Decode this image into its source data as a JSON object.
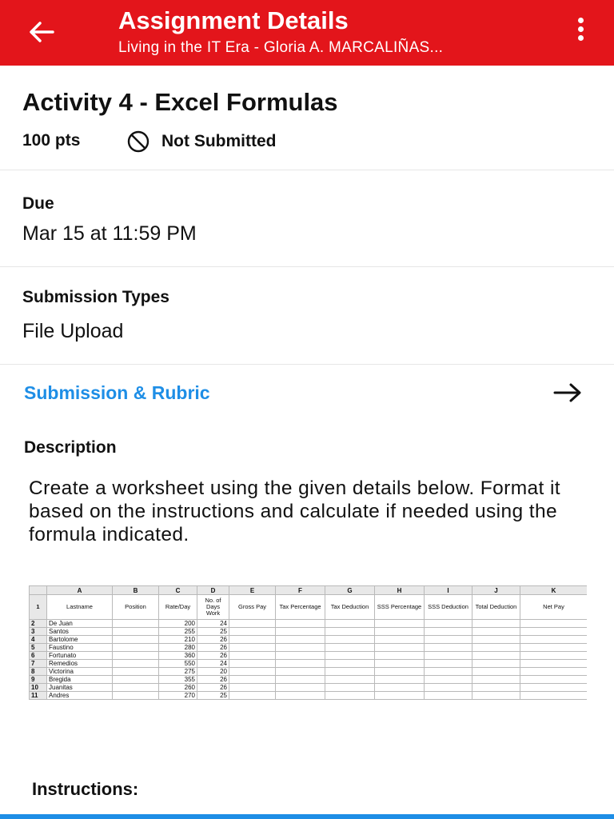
{
  "app_bar": {
    "title": "Assignment Details",
    "subtitle": "Living in the IT Era - Gloria A. MARCALIÑAS...",
    "back_icon": "arrow-left-icon",
    "menu_icon": "more-vertical-icon",
    "color": "#e3151b"
  },
  "assignment": {
    "title": "Activity 4 - Excel Formulas",
    "points": "100 pts",
    "status": "Not Submitted",
    "status_icon": "not-allowed-icon"
  },
  "due": {
    "label": "Due",
    "value": "Mar 15 at 11:59 PM"
  },
  "submission_types": {
    "label": "Submission Types",
    "value": "File Upload"
  },
  "submission_rubric": {
    "label": "Submission & Rubric",
    "icon": "arrow-right-icon",
    "color": "#1e8ee6"
  },
  "description": {
    "label": "Description",
    "text": "Create a worksheet using the given details below.  Format it based on the instructions and calculate if needed using the formula indicated."
  },
  "spreadsheet": {
    "column_letters": [
      "A",
      "B",
      "C",
      "D",
      "E",
      "F",
      "G",
      "H",
      "I",
      "J",
      "K"
    ],
    "headers": [
      "Lastname",
      "Position",
      "Rate/Day",
      "No. of Days Work",
      "Gross Pay",
      "Tax Percentage",
      "Tax Deduction",
      "SSS Percentage",
      "SSS Deduction",
      "Total Deduction",
      "Net Pay"
    ],
    "rows": [
      [
        "De Juan",
        "",
        "200",
        "24"
      ],
      [
        "Santos",
        "",
        "255",
        "25"
      ],
      [
        "Bartolome",
        "",
        "210",
        "26"
      ],
      [
        "Faustino",
        "",
        "280",
        "26"
      ],
      [
        "Fortunato",
        "",
        "360",
        "26"
      ],
      [
        "Remedios",
        "",
        "550",
        "24"
      ],
      [
        "Victorina",
        "",
        "275",
        "20"
      ],
      [
        "Bregida",
        "",
        "355",
        "26"
      ],
      [
        "Juanitas",
        "",
        "260",
        "26"
      ],
      [
        "Andres",
        "",
        "270",
        "25"
      ]
    ]
  },
  "instructions": {
    "label": "Instructions:"
  }
}
